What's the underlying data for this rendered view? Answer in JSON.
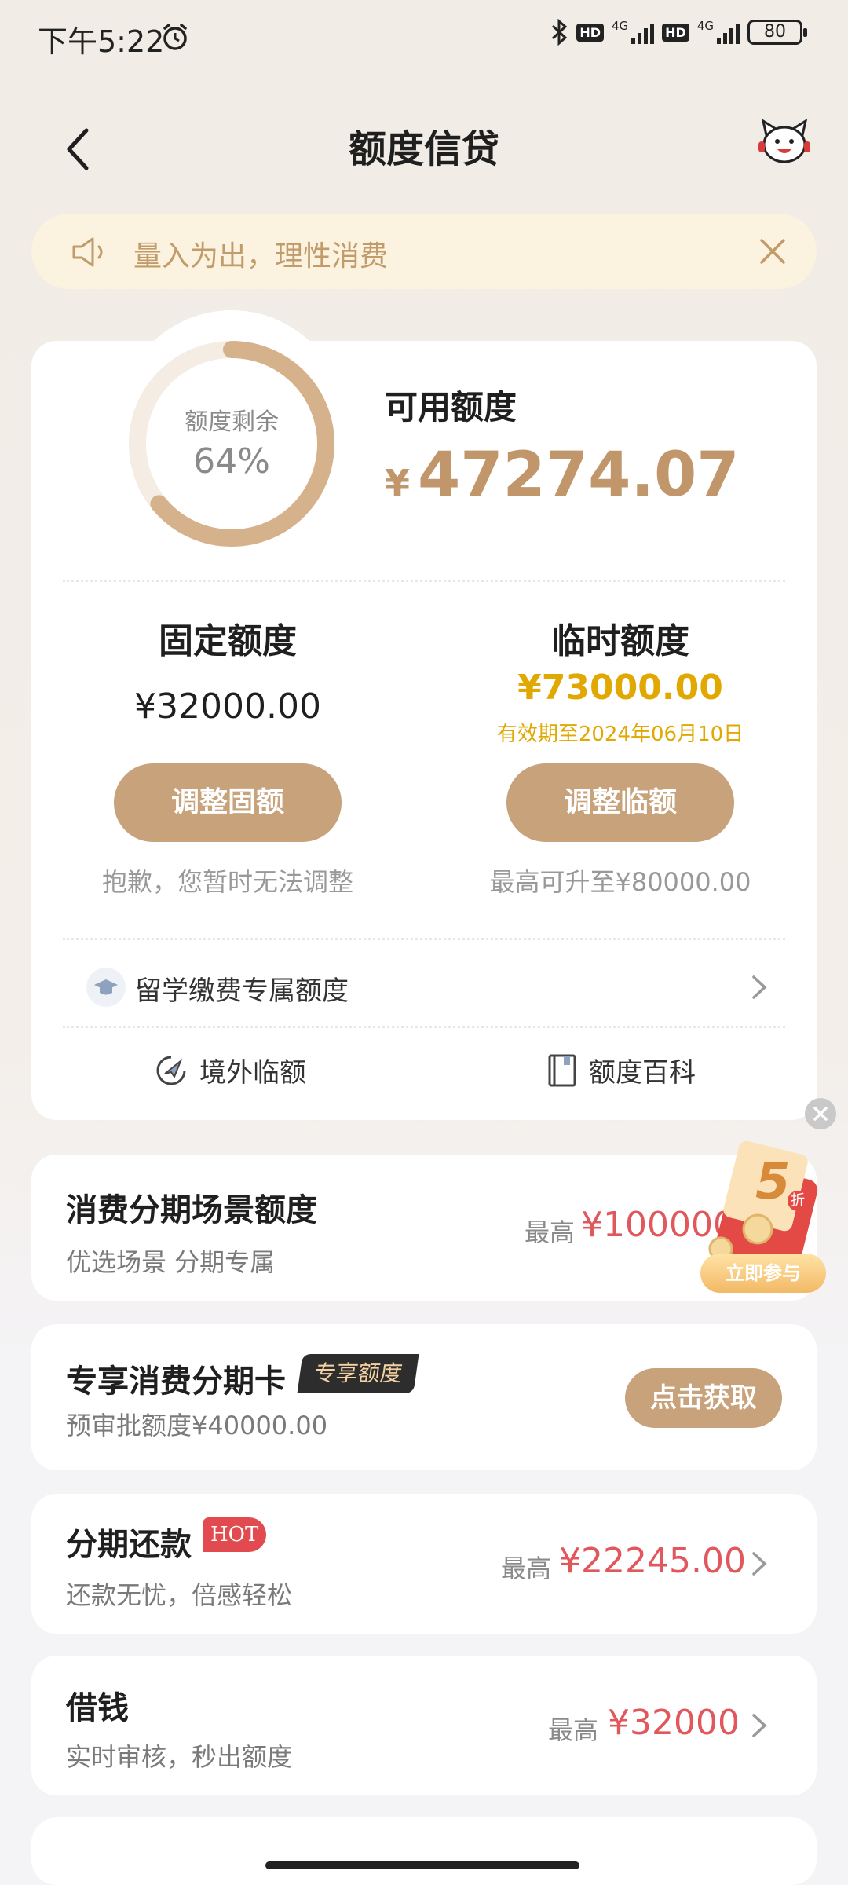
{
  "status_bar": {
    "time": "下午5:22",
    "hd1": "HD",
    "net1": "4G",
    "hd2": "HD",
    "net2": "4G",
    "battery": "80"
  },
  "header": {
    "title": "额度信贷"
  },
  "notice": {
    "text": "量入为出，理性消费"
  },
  "quota": {
    "ring_label": "额度剩余",
    "ring_percent": "64%",
    "ring_fraction": 0.64,
    "available_label": "可用额度",
    "available_symbol": "¥",
    "available_value": "47274.07",
    "fixed": {
      "title": "固定额度",
      "value": "¥32000.00",
      "button": "调整固额",
      "note": "抱歉，您暂时无法调整"
    },
    "temp": {
      "title": "临时额度",
      "value": "¥73000.00",
      "validity": "有效期至2024年06月10日",
      "button": "调整临额",
      "note": "最高可升至¥80000.00"
    },
    "study_label": "留学缴费专属额度",
    "overseas_label": "境外临额",
    "wiki_label": "额度百科"
  },
  "promo": {
    "discount": "5",
    "discount_unit": "折",
    "button": "立即参与"
  },
  "rows": {
    "consumer": {
      "title": "消费分期场景额度",
      "subtitle": "优选场景 分期专属",
      "max_label": "最高",
      "max_value": "¥100000"
    },
    "card": {
      "title": "专享消费分期卡",
      "badge": "专享额度",
      "subtitle": "预审批额度¥40000.00",
      "button": "点击获取"
    },
    "installment": {
      "title": "分期还款",
      "badge": "HOT",
      "subtitle": "还款无忧，倍感轻松",
      "max_label": "最高",
      "max_value": "¥22245.00"
    },
    "borrow": {
      "title": "借钱",
      "subtitle": "实时审核，秒出额度",
      "max_label": "最高",
      "max_value": "¥32000"
    }
  },
  "colors": {
    "accent": "#c7a27a",
    "gold": "#e0a800",
    "red": "#e0575c"
  }
}
